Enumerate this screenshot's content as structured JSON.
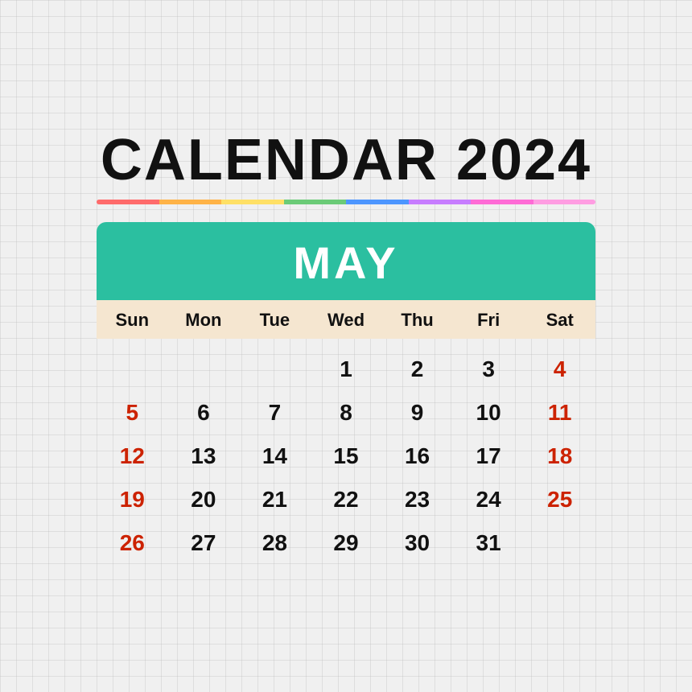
{
  "title": "CALENDAR 2024",
  "month": "MAY",
  "rainbowColors": [
    "#ff6b6b",
    "#ffb347",
    "#ffe066",
    "#6bcb77",
    "#4d96ff",
    "#c77dff",
    "#ff6bd6",
    "#ff9de2"
  ],
  "dayHeaders": [
    "Sun",
    "Mon",
    "Tue",
    "Wed",
    "Thu",
    "Fri",
    "Sat"
  ],
  "weeks": [
    [
      "",
      "",
      "",
      "1",
      "2",
      "3",
      "4"
    ],
    [
      "5",
      "6",
      "7",
      "8",
      "9",
      "10",
      "11"
    ],
    [
      "12",
      "13",
      "14",
      "15",
      "16",
      "17",
      "18"
    ],
    [
      "19",
      "20",
      "21",
      "22",
      "23",
      "24",
      "25"
    ],
    [
      "26",
      "27",
      "28",
      "29",
      "30",
      "31",
      ""
    ]
  ],
  "redDays": [
    "4",
    "5",
    "11",
    "12",
    "18",
    "19",
    "25",
    "26"
  ],
  "accentColor": "#2bbfa0",
  "headerBg": "#f5e6d0"
}
